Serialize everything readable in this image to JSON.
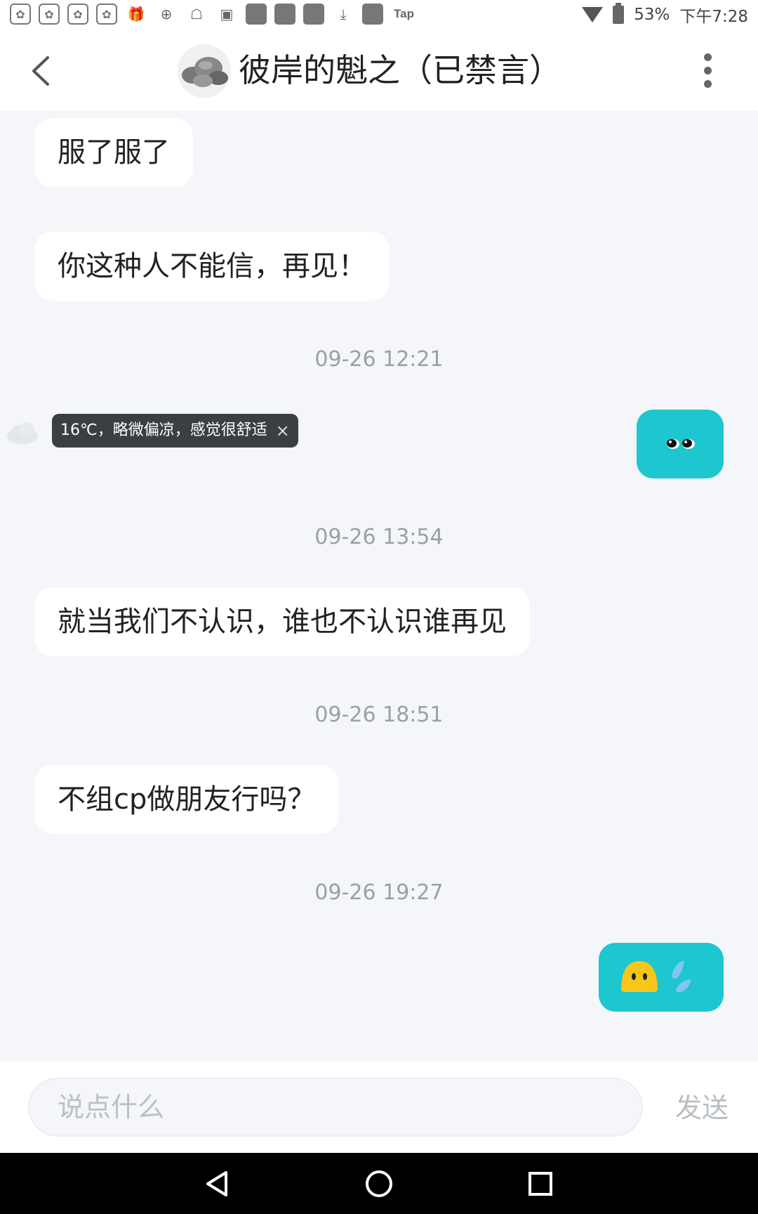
{
  "status_bar": {
    "battery_percent": "53%",
    "time": "下午7:28",
    "tap_label": "Tap"
  },
  "header": {
    "title": "彼岸的魁之（已禁言）",
    "back_icon": "chevron-left-icon",
    "more_icon": "vertical-dots-icon"
  },
  "messages": [
    {
      "type": "incoming",
      "text": "服了服了"
    },
    {
      "type": "incoming",
      "text": "你这种人不能信，再见！"
    },
    {
      "type": "timestamp",
      "text": "09-26 12:21"
    },
    {
      "type": "outgoing",
      "emoji": "peeking-eyes-emoji"
    },
    {
      "type": "timestamp",
      "text": "09-26 13:54"
    },
    {
      "type": "incoming",
      "text": "就当我们不认识，谁也不认识谁再见"
    },
    {
      "type": "timestamp",
      "text": "09-26 18:51"
    },
    {
      "type": "incoming",
      "text": "不组cp做朋友行吗？"
    },
    {
      "type": "timestamp",
      "text": "09-26 19:27"
    },
    {
      "type": "outgoing",
      "emoji": "sweat-drop-emoji"
    }
  ],
  "weather_tip": {
    "text": "16℃，略微偏凉，感觉很舒适",
    "close": "×"
  },
  "input": {
    "placeholder": "说点什么",
    "send_label": "发送"
  },
  "colors": {
    "accent": "#1ec6cf",
    "background": "#f4f6f9",
    "bubble": "#ffffff"
  }
}
